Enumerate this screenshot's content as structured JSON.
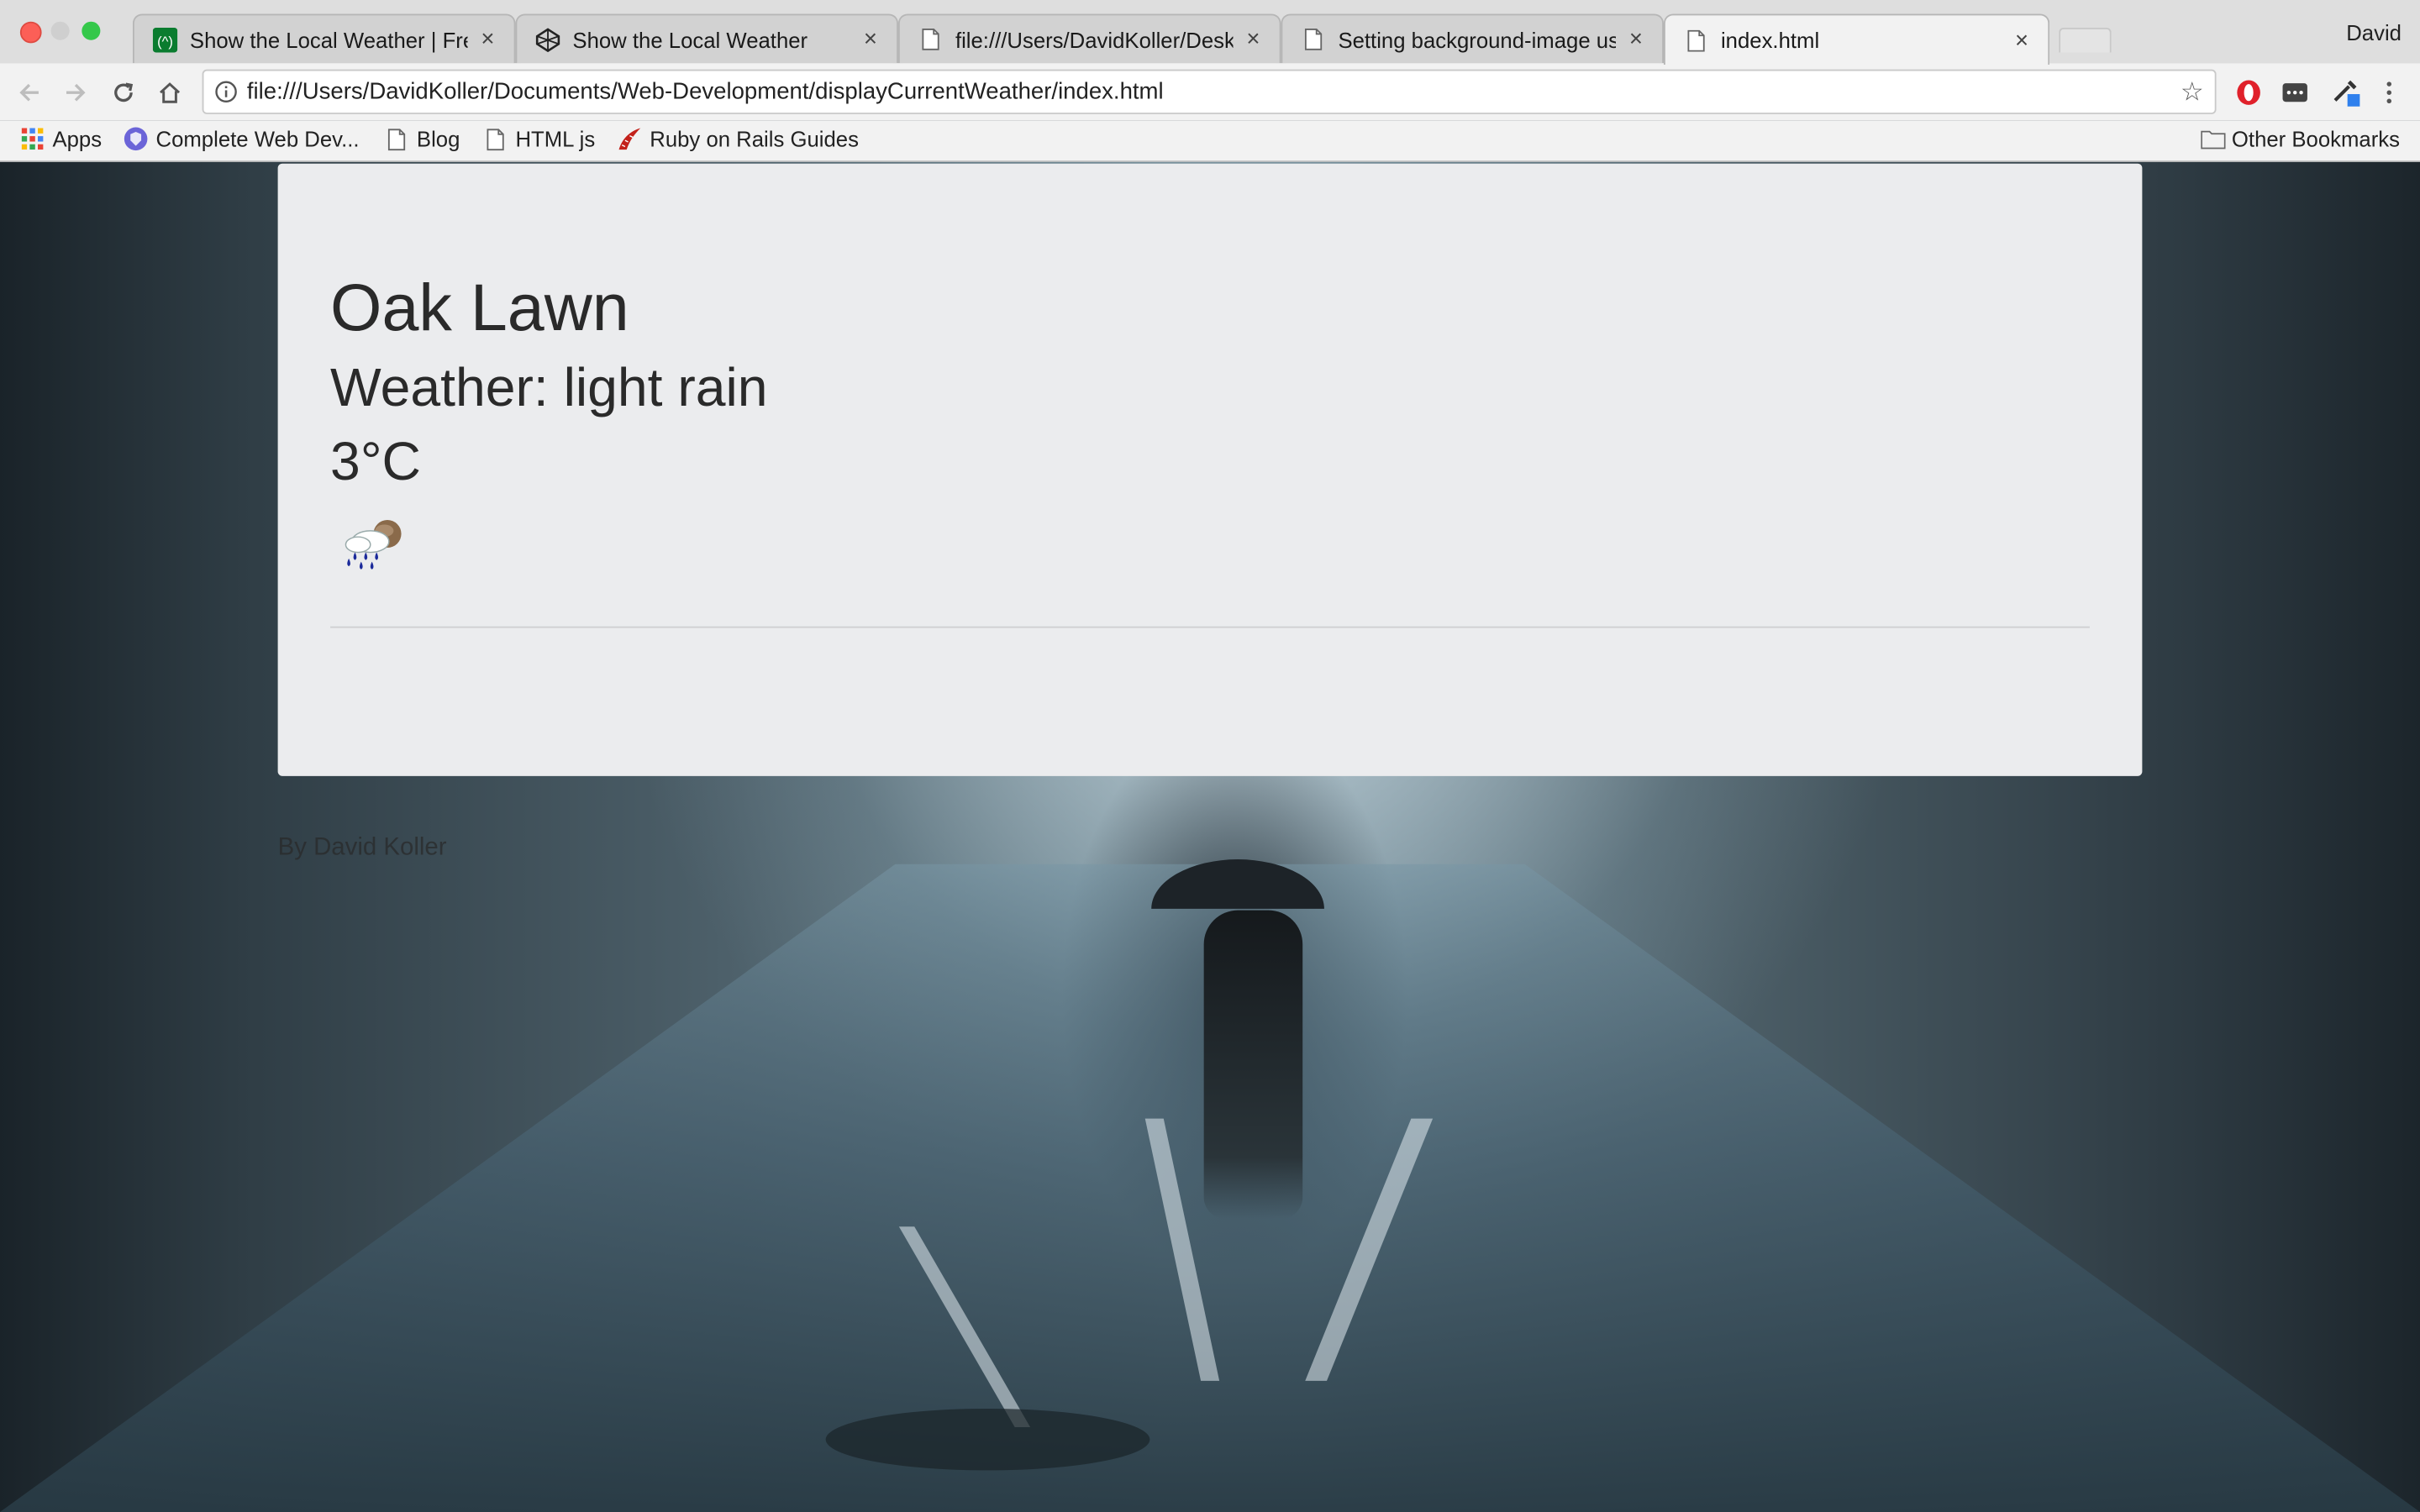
{
  "browser": {
    "tabs": [
      {
        "label": "Show the Local Weather | Free",
        "favicon": "freecodecamp-icon",
        "active": false
      },
      {
        "label": "Show the Local Weather",
        "favicon": "codepen-icon",
        "active": false
      },
      {
        "label": "file:///Users/DavidKoller/Deskto",
        "favicon": "document-icon",
        "active": false
      },
      {
        "label": "Setting background-image usi",
        "favicon": "document-icon",
        "active": false
      },
      {
        "label": "index.html",
        "favicon": "document-icon",
        "active": true
      }
    ],
    "profile_name": "David",
    "address": "file:///Users/DavidKoller/Documents/Web-Development/displayCurrentWeather/index.html",
    "bookmarks": [
      {
        "label": "Apps",
        "icon": "apps-grid-icon"
      },
      {
        "label": "Complete Web Dev...",
        "icon": "shield-icon"
      },
      {
        "label": "Blog",
        "icon": "document-icon"
      },
      {
        "label": "HTML js",
        "icon": "document-icon"
      },
      {
        "label": "Ruby on Rails Guides",
        "icon": "rails-icon"
      }
    ],
    "other_bookmarks": "Other Bookmarks"
  },
  "weather": {
    "city": "Oak Lawn",
    "description": "Weather: light rain",
    "temperature": "3°C",
    "icon": "light-rain-icon"
  },
  "footer": {
    "credit": "By David Koller"
  },
  "colors": {
    "card_background": "#ebecee",
    "text": "#2a2a2a"
  }
}
